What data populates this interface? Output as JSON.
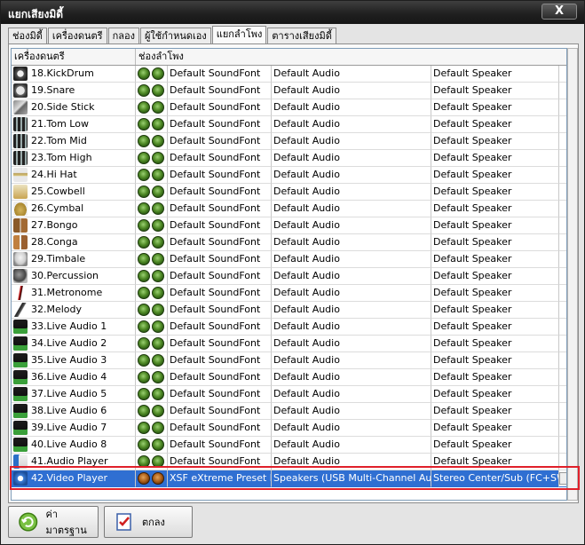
{
  "window": {
    "title": "แยกเสียงมิดี้",
    "close_label": "X"
  },
  "tabs": [
    {
      "label": "ช่องมิดี้",
      "active": false
    },
    {
      "label": "เครื่องดนตรี",
      "active": false
    },
    {
      "label": "กลอง",
      "active": false
    },
    {
      "label": "ผู้ใช้กำหนดเอง",
      "active": false
    },
    {
      "label": "แยกลำโพง",
      "active": true
    },
    {
      "label": "ตารางเสียงมิดี้",
      "active": false
    }
  ],
  "grid": {
    "headers": {
      "instrument": "เครื่องดนตรี",
      "channel": "ช่องลำโพง"
    },
    "rows": [
      {
        "instrument": "18.KickDrum",
        "icon": "kick-drum-icon",
        "soundfont": "Default SoundFont",
        "audio": "Default Audio",
        "speaker": "Default Speaker"
      },
      {
        "instrument": "19.Snare",
        "icon": "snare-icon",
        "soundfont": "Default SoundFont",
        "audio": "Default Audio",
        "speaker": "Default Speaker"
      },
      {
        "instrument": "20.Side Stick",
        "icon": "side-stick-icon",
        "soundfont": "Default SoundFont",
        "audio": "Default Audio",
        "speaker": "Default Speaker"
      },
      {
        "instrument": "21.Tom Low",
        "icon": "tom-icon",
        "soundfont": "Default SoundFont",
        "audio": "Default Audio",
        "speaker": "Default Speaker"
      },
      {
        "instrument": "22.Tom Mid",
        "icon": "tom-icon",
        "soundfont": "Default SoundFont",
        "audio": "Default Audio",
        "speaker": "Default Speaker"
      },
      {
        "instrument": "23.Tom High",
        "icon": "tom-icon",
        "soundfont": "Default SoundFont",
        "audio": "Default Audio",
        "speaker": "Default Speaker"
      },
      {
        "instrument": "24.Hi Hat",
        "icon": "hi-hat-icon",
        "soundfont": "Default SoundFont",
        "audio": "Default Audio",
        "speaker": "Default Speaker"
      },
      {
        "instrument": "25.Cowbell",
        "icon": "cowbell-icon",
        "soundfont": "Default SoundFont",
        "audio": "Default Audio",
        "speaker": "Default Speaker"
      },
      {
        "instrument": "26.Cymbal",
        "icon": "cymbal-icon",
        "soundfont": "Default SoundFont",
        "audio": "Default Audio",
        "speaker": "Default Speaker"
      },
      {
        "instrument": "27.Bongo",
        "icon": "bongo-icon",
        "soundfont": "Default SoundFont",
        "audio": "Default Audio",
        "speaker": "Default Speaker"
      },
      {
        "instrument": "28.Conga",
        "icon": "conga-icon",
        "soundfont": "Default SoundFont",
        "audio": "Default Audio",
        "speaker": "Default Speaker"
      },
      {
        "instrument": "29.Timbale",
        "icon": "timbale-icon",
        "soundfont": "Default SoundFont",
        "audio": "Default Audio",
        "speaker": "Default Speaker"
      },
      {
        "instrument": "30.Percussion",
        "icon": "percussion-icon",
        "soundfont": "Default SoundFont",
        "audio": "Default Audio",
        "speaker": "Default Speaker"
      },
      {
        "instrument": "31.Metronome",
        "icon": "metronome-icon",
        "soundfont": "Default SoundFont",
        "audio": "Default Audio",
        "speaker": "Default Speaker"
      },
      {
        "instrument": "32.Melody",
        "icon": "microphone-icon",
        "soundfont": "Default SoundFont",
        "audio": "Default Audio",
        "speaker": "Default Speaker"
      },
      {
        "instrument": "33.Live Audio 1",
        "icon": "live-audio-icon",
        "soundfont": "Default SoundFont",
        "audio": "Default Audio",
        "speaker": "Default Speaker"
      },
      {
        "instrument": "34.Live Audio 2",
        "icon": "live-audio-icon",
        "soundfont": "Default SoundFont",
        "audio": "Default Audio",
        "speaker": "Default Speaker"
      },
      {
        "instrument": "35.Live Audio 3",
        "icon": "live-audio-icon",
        "soundfont": "Default SoundFont",
        "audio": "Default Audio",
        "speaker": "Default Speaker"
      },
      {
        "instrument": "36.Live Audio 4",
        "icon": "live-audio-icon",
        "soundfont": "Default SoundFont",
        "audio": "Default Audio",
        "speaker": "Default Speaker"
      },
      {
        "instrument": "37.Live Audio 5",
        "icon": "live-audio-icon",
        "soundfont": "Default SoundFont",
        "audio": "Default Audio",
        "speaker": "Default Speaker"
      },
      {
        "instrument": "38.Live Audio 6",
        "icon": "live-audio-icon",
        "soundfont": "Default SoundFont",
        "audio": "Default Audio",
        "speaker": "Default Speaker"
      },
      {
        "instrument": "39.Live Audio 7",
        "icon": "live-audio-icon",
        "soundfont": "Default SoundFont",
        "audio": "Default Audio",
        "speaker": "Default Speaker"
      },
      {
        "instrument": "40.Live Audio 8",
        "icon": "live-audio-icon",
        "soundfont": "Default SoundFont",
        "audio": "Default Audio",
        "speaker": "Default Speaker"
      },
      {
        "instrument": "41.Audio Player",
        "icon": "audio-player-icon",
        "soundfont": "Default SoundFont",
        "audio": "Default Audio",
        "speaker": "Default Speaker"
      },
      {
        "instrument": "42.Video Player",
        "icon": "video-player-icon",
        "soundfont": "XSF eXtreme Preset Ful",
        "audio": "Speakers (USB Multi-Channel Audio D",
        "speaker": "Stereo Center/Sub (FC+SW)",
        "selected": true
      }
    ]
  },
  "buttons": {
    "default_label": "ค่ามาตรฐาน",
    "ok_label": "ตกลง"
  },
  "colors": {
    "selection": "#2f6fd2",
    "highlight_border": "#e0202a",
    "indicator_green": "#4f8a26",
    "indicator_orange": "#b0631c"
  }
}
